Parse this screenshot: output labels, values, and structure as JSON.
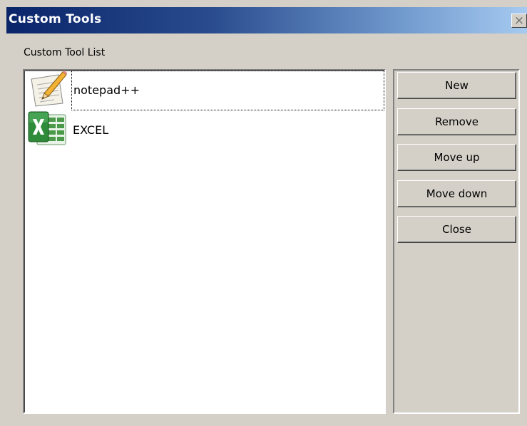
{
  "window": {
    "title": "Custom Tools",
    "close_symbol": "×"
  },
  "section_label": "Custom Tool List",
  "tools": [
    {
      "label": "notepad++",
      "icon": "notepad-icon",
      "selected": true
    },
    {
      "label": "EXCEL",
      "icon": "excel-icon",
      "selected": false
    }
  ],
  "buttons": {
    "new": "New",
    "remove": "Remove",
    "move_up": "Move up",
    "move_down": "Move down",
    "close": "Close"
  },
  "colors": {
    "titlebar_start": "#0a246a",
    "titlebar_end": "#a6caf0",
    "window_bg": "#d4d0c8",
    "excel_green": "#2e8b3a"
  }
}
